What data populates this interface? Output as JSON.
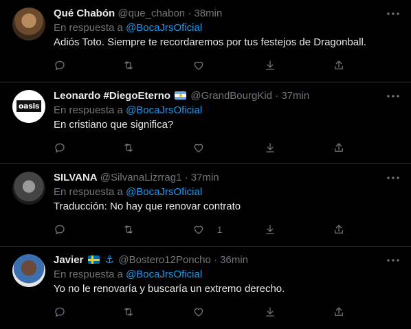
{
  "reply_prefix": "En respuesta a",
  "tweets": [
    {
      "name": "Qué Chabón",
      "handle": "@que_chabon",
      "separator": "·",
      "time": "38min",
      "reply_to": "@BocaJrsOficial",
      "text": "Adiós Toto. Siempre te recordaremos por tus festejos de Dragonball.",
      "like_count": ""
    },
    {
      "name": "Leonardo #DiegoEterno",
      "handle": "@GrandBourgKid",
      "separator": "·",
      "time": "37min",
      "reply_to": "@BocaJrsOficial",
      "text": "En cristiano que significa?",
      "avatar_text": "oasis",
      "like_count": ""
    },
    {
      "name": "SILVANA",
      "handle": "@SilvanaLizrrag1",
      "separator": "·",
      "time": "37min",
      "reply_to": "@BocaJrsOficial",
      "text": "Traducción: No hay que renovar contrato",
      "like_count": "1"
    },
    {
      "name": "Javier",
      "handle": "@Bostero12Poncho",
      "separator": "·",
      "time": "36min",
      "reply_to": "@BocaJrsOficial",
      "text": "Yo no le renovaría y buscaría un extremo derecho.",
      "anchor_emoji": "⚓",
      "like_count": ""
    }
  ],
  "colors": {
    "background": "#000000",
    "text": "#e7e9ea",
    "secondary": "#71767b",
    "link": "#1d9bf0",
    "divider": "#2f3336"
  },
  "icons": [
    "more-icon",
    "reply-icon",
    "retweet-icon",
    "like-icon",
    "download-icon",
    "share-icon"
  ]
}
